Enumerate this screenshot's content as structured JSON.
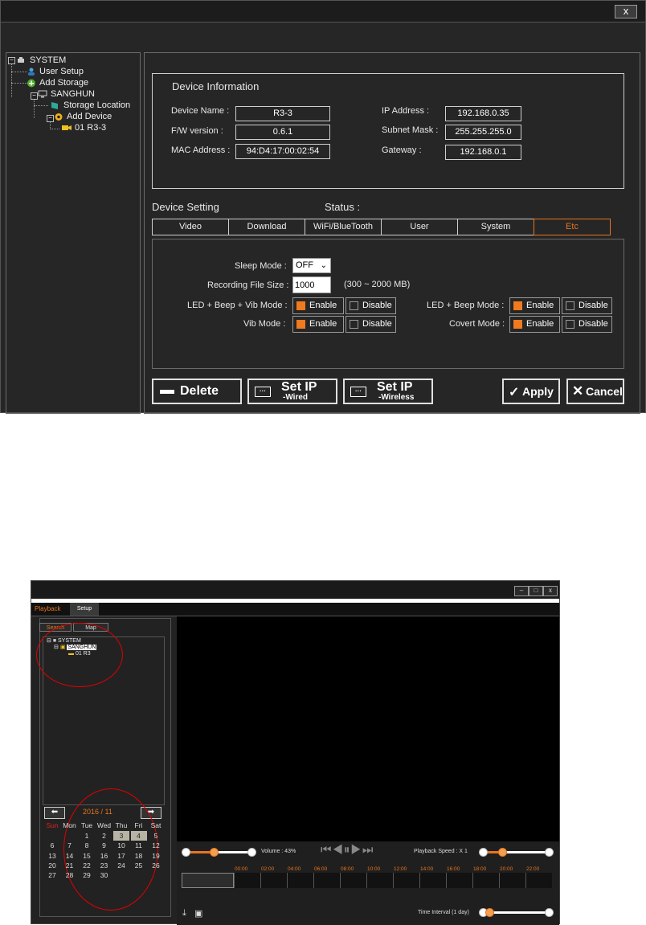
{
  "setup_window": {
    "close_label": "x",
    "tree": {
      "root": "SYSTEM",
      "user_setup": "User Setup",
      "add_storage": "Add Storage",
      "group": "SANGHUN",
      "storage_location": "Storage Location",
      "add_device": "Add Device",
      "device": "01 R3-3"
    },
    "device_info": {
      "title": "Device Information",
      "device_name_label": "Device Name :",
      "device_name": "R3-3",
      "fw_label": "F/W version :",
      "fw": "0.6.1",
      "mac_label": "MAC Address :",
      "mac": "94:D4:17:00:02:54",
      "ip_label": "IP Address :",
      "ip": "192.168.0.35",
      "subnet_label": "Subnet Mask :",
      "subnet": "255.255.255.0",
      "gateway_label": "Gateway :",
      "gateway": "192.168.0.1"
    },
    "device_setting_label": "Device Setting",
    "status_label": "Status :",
    "tabs": [
      "Video",
      "Download",
      "WiFi/BlueTooth",
      "User",
      "System",
      "Etc"
    ],
    "active_tab": "Etc",
    "etc": {
      "sleep_mode_label": "Sleep Mode :",
      "sleep_mode_value": "OFF",
      "rec_size_label": "Recording File Size :",
      "rec_size_value": "1000",
      "rec_size_range": "(300 ~ 2000 MB)",
      "led_beep_vib_label": "LED + Beep + Vib Mode :",
      "vib_label": "Vib Mode :",
      "led_beep_label": "LED + Beep Mode :",
      "covert_label": "Covert Mode :",
      "enable": "Enable",
      "disable": "Disable"
    },
    "buttons": {
      "delete": "Delete",
      "set_ip": "Set IP",
      "wired": "-Wired",
      "wireless": "-Wireless",
      "apply": "Apply",
      "cancel": "Cancel"
    },
    "colors": {
      "accent": "#e8741e",
      "bg": "#262626"
    }
  },
  "playback_window": {
    "main_tabs": [
      "Playback",
      "Setup"
    ],
    "active_main_tab": "Playback",
    "side_tabs": [
      "Search",
      "Map"
    ],
    "tree": {
      "root": "SYSTEM",
      "group": "SANGHUN",
      "device": "01 R3"
    },
    "calendar": {
      "month_label": "2016 / 11",
      "weekdays": [
        "Sun",
        "Mon",
        "Tue",
        "Wed",
        "Thu",
        "Fri",
        "Sat"
      ],
      "weeks": [
        [
          "",
          "",
          "1",
          "2",
          "3",
          "4",
          "5"
        ],
        [
          "6",
          "7",
          "8",
          "9",
          "10",
          "11",
          "12"
        ],
        [
          "13",
          "14",
          "15",
          "16",
          "17",
          "18",
          "19"
        ],
        [
          "20",
          "21",
          "22",
          "23",
          "24",
          "25",
          "26"
        ],
        [
          "27",
          "28",
          "29",
          "30",
          "",
          "",
          ""
        ]
      ],
      "highlighted": [
        "3",
        "4"
      ]
    },
    "volume_label": "Volume : 43%",
    "volume": 0.43,
    "speed_label": "Playback Speed : X 1",
    "timeline_hours": [
      "00:00",
      "02:00",
      "04:00",
      "06:00",
      "08:00",
      "10:00",
      "12:00",
      "14:00",
      "16:00",
      "18:00",
      "20:00",
      "22:00"
    ],
    "time_interval_label": "Time Interval (1 day)",
    "window_controls": [
      "–",
      "□",
      "x"
    ]
  }
}
